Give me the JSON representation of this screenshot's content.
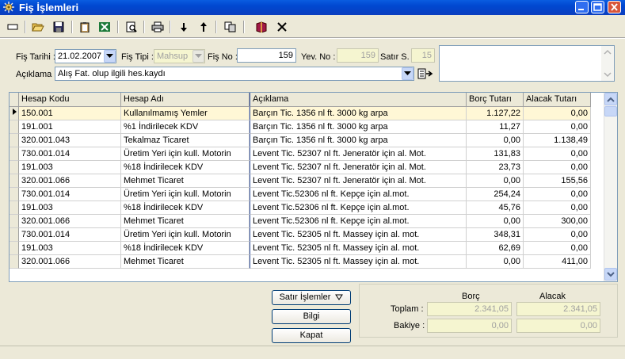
{
  "window": {
    "title": "Fiş İşlemleri"
  },
  "toolbar": {
    "icons": [
      "new-icon",
      "open-folder-icon",
      "save-icon",
      "clipboard-icon",
      "excel-icon",
      "print-preview-icon",
      "printer-icon",
      "arrow-down-icon",
      "arrow-up-icon",
      "copy-icon",
      "book-icon",
      "close-icon"
    ]
  },
  "form": {
    "fis_tarihi_label": "Fiş Tarihi :",
    "fis_tarihi_value": "21.02.2007",
    "fis_tipi_label": "Fiş Tipi :",
    "fis_tipi_value": "Mahsup",
    "fis_no_label": "Fiş No :",
    "fis_no_value": "159",
    "yev_no_label": "Yev. No :",
    "yev_no_value": "159",
    "satir_s_label": "Satır S. :",
    "satir_s_value": "15",
    "aciklama_label": "Açıklama :",
    "aciklama_value": "Alış Fat. olup ilgili hes.kaydı"
  },
  "grid": {
    "columns": [
      "Hesap Kodu",
      "Hesap Adı",
      "Açıklama",
      "Borç Tutarı",
      "Alacak Tutarı"
    ],
    "rows": [
      [
        "150.001",
        "Kullanılmamış Yemler",
        "Barçın Tic. 1356 nl ft. 3000 kg arpa",
        "1.127,22",
        "0,00"
      ],
      [
        "191.001",
        "%1 İndirilecek KDV",
        "Barçın Tic. 1356 nl ft. 3000 kg arpa",
        "11,27",
        "0,00"
      ],
      [
        "320.001.043",
        "Tekalmaz Ticaret",
        "Barçın Tic. 1356 nl ft. 3000 kg arpa",
        "0,00",
        "1.138,49"
      ],
      [
        "730.001.014",
        "Üretim Yeri için kull. Motorin",
        "Levent Tic. 52307 nl ft. Jeneratör için al. Mot.",
        "131,83",
        "0,00"
      ],
      [
        "191.003",
        "%18 İndirilecek KDV",
        "Levent Tic. 52307 nl ft. Jeneratör için al. Mot.",
        "23,73",
        "0,00"
      ],
      [
        "320.001.066",
        "Mehmet Ticaret",
        "Levent Tic. 52307 nl ft. Jeneratör için al. Mot.",
        "0,00",
        "155,56"
      ],
      [
        "730.001.014",
        "Üretim Yeri için kull. Motorin",
        "Levent Tic.52306 nl ft. Kepçe için al.mot.",
        "254,24",
        "0,00"
      ],
      [
        "191.003",
        "%18 İndirilecek KDV",
        "Levent Tic.52306 nl ft. Kepçe için al.mot.",
        "45,76",
        "0,00"
      ],
      [
        "320.001.066",
        "Mehmet Ticaret",
        "Levent Tic.52306 nl ft. Kepçe için al.mot.",
        "0,00",
        "300,00"
      ],
      [
        "730.001.014",
        "Üretim Yeri için kull. Motorin",
        "Levent Tic. 52305 nl ft. Massey için al. mot.",
        "348,31",
        "0,00"
      ],
      [
        "191.003",
        "%18 İndirilecek KDV",
        "Levent Tic. 52305 nl ft. Massey için al. mot.",
        "62,69",
        "0,00"
      ],
      [
        "320.001.066",
        "Mehmet Ticaret",
        "Levent Tic. 52305 nl ft. Massey için al. mot.",
        "0,00",
        "411,00"
      ]
    ],
    "selected_row": 0
  },
  "buttons": {
    "satir_islemler": "Satır İşlemler",
    "bilgi": "Bilgi",
    "kapat": "Kapat"
  },
  "totals": {
    "borc_header": "Borç",
    "alacak_header": "Alacak",
    "toplam_label": "Toplam :",
    "bakiye_label": "Bakiye :",
    "toplam_borc": "2.341,05",
    "toplam_alacak": "2.341,05",
    "bakiye_borc": "0,00",
    "bakiye_alacak": "0,00"
  },
  "colors": {
    "titlebar": "#0047d0",
    "window_bg": "#ece9d8",
    "disabled_field": "#f5f5d0",
    "selected_row": "#fff7d6"
  }
}
